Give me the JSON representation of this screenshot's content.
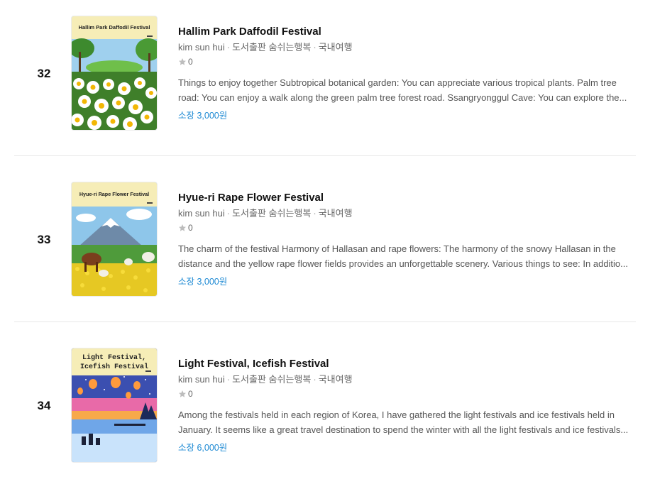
{
  "items": [
    {
      "rank": "32",
      "title": "Hallim Park Daffodil Festival",
      "cover_title": "Hallim Park Daffodil Festival",
      "author": "kim sun hui",
      "publisher": "도서출판 숨쉬는행복",
      "category": "국내여행",
      "rating": "0",
      "desc_line1": "Things to enjoy together Subtropical botanical garden: You can appreciate various tropical plants. Palm tree",
      "desc_line2": "road: You can enjoy a walk along the green palm tree forest road. Ssangryonggul Cave: You can explore the...",
      "price": "소장 3,000원"
    },
    {
      "rank": "33",
      "title": "Hyue-ri Rape Flower Festival",
      "cover_title": "Hyue-ri Rape Flower Festival",
      "author": "kim sun hui",
      "publisher": "도서출판 숨쉬는행복",
      "category": "국내여행",
      "rating": "0",
      "desc_line1": "The charm of the festival Harmony of Hallasan and rape flowers: The harmony of the snowy Hallasan in the",
      "desc_line2": "distance and the yellow rape flower fields provides an unforgettable scenery. Various things to see: In additio...",
      "price": "소장 3,000원"
    },
    {
      "rank": "34",
      "title": "Light Festival, Icefish Festival",
      "cover_title_1": "Light Festival,",
      "cover_title_2": "Icefish Festival",
      "author": "kim sun hui",
      "publisher": "도서출판 숨쉬는행복",
      "category": "국내여행",
      "rating": "0",
      "desc_line1": "Among the festivals held in each region of Korea, I have gathered the light festivals and ice festivals held in",
      "desc_line2": "January. It seems like a great travel destination to spend the winter with all the light festivals and ice festivals...",
      "price": "소장 6,000원"
    }
  ],
  "colors": {
    "price": "#1e8ad4",
    "meta": "#666666",
    "star": "#bdbdbd",
    "divider": "#e8e8e8"
  }
}
